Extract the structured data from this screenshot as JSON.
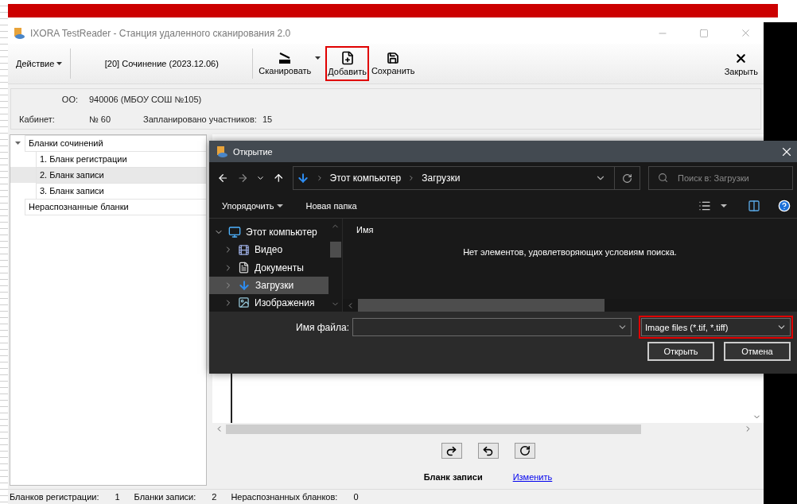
{
  "window": {
    "title": "IXORA TestReader - Станция удаленного сканирования 2.0"
  },
  "toolbar": {
    "action_menu": "Действие",
    "exam": "[20] Сочинение (2023.12.06)",
    "close": "Закрыть",
    "buttons": [
      {
        "kind": "scan",
        "label": "Сканировать",
        "highlighted": false
      },
      {
        "kind": "add",
        "label": "Добавить",
        "highlighted": true
      },
      {
        "kind": "save",
        "label": "Сохранить",
        "highlighted": false
      }
    ]
  },
  "info": {
    "org_label": "ОО:",
    "org_value": "940006 (МБОУ СОШ №105)",
    "room_label": "Кабинет:",
    "room_value": "№ 60",
    "planned_label": "Запланировано участников:",
    "planned_value": "15"
  },
  "tree": [
    {
      "label": "Бланки сочинений",
      "expanded": true,
      "selected": false,
      "children": [
        {
          "label": "1. Бланк регистрации",
          "selected": false
        },
        {
          "label": "2. Бланк записи",
          "selected": true
        },
        {
          "label": "3. Бланк записи",
          "selected": false
        }
      ]
    },
    {
      "label": "Нераспознанные бланки",
      "selected": false
    }
  ],
  "viewer": {
    "caption": "Бланк записи",
    "change_link": "Изменить"
  },
  "status_bar": [
    {
      "label": "Бланков регистрации:",
      "value": "1"
    },
    {
      "label": "Бланки записи:",
      "value": "2"
    },
    {
      "label": "Нераспознанных бланков:",
      "value": "0"
    }
  ],
  "dialog": {
    "title": "Открытие",
    "breadcrumb": [
      "Этот компьютер",
      "Загрузки"
    ],
    "search_placeholder": "Поиск в: Загрузки",
    "organize": "Упорядочить",
    "new_folder": "Новая папка",
    "nav": [
      {
        "label": "Этот компьютер",
        "kind": "computer",
        "expanded": true,
        "selected": false,
        "children": [
          {
            "label": "Видео",
            "kind": "video",
            "expanded": false,
            "selected": false
          },
          {
            "label": "Документы",
            "kind": "documents",
            "expanded": false,
            "selected": false
          },
          {
            "label": "Загрузки",
            "kind": "downloads",
            "expanded": false,
            "selected": true
          },
          {
            "label": "Изображения",
            "kind": "images",
            "expanded": false,
            "selected": false
          }
        ]
      }
    ],
    "column": "Имя",
    "empty_message": "Нет элементов, удовлетворяющих условиям поиска.",
    "filename_label": "Имя файла:",
    "filetype": {
      "value": "Image files (*.tif, *.tiff)",
      "highlighted": true
    },
    "buttons": [
      "Открыть",
      "Отмена"
    ]
  }
}
